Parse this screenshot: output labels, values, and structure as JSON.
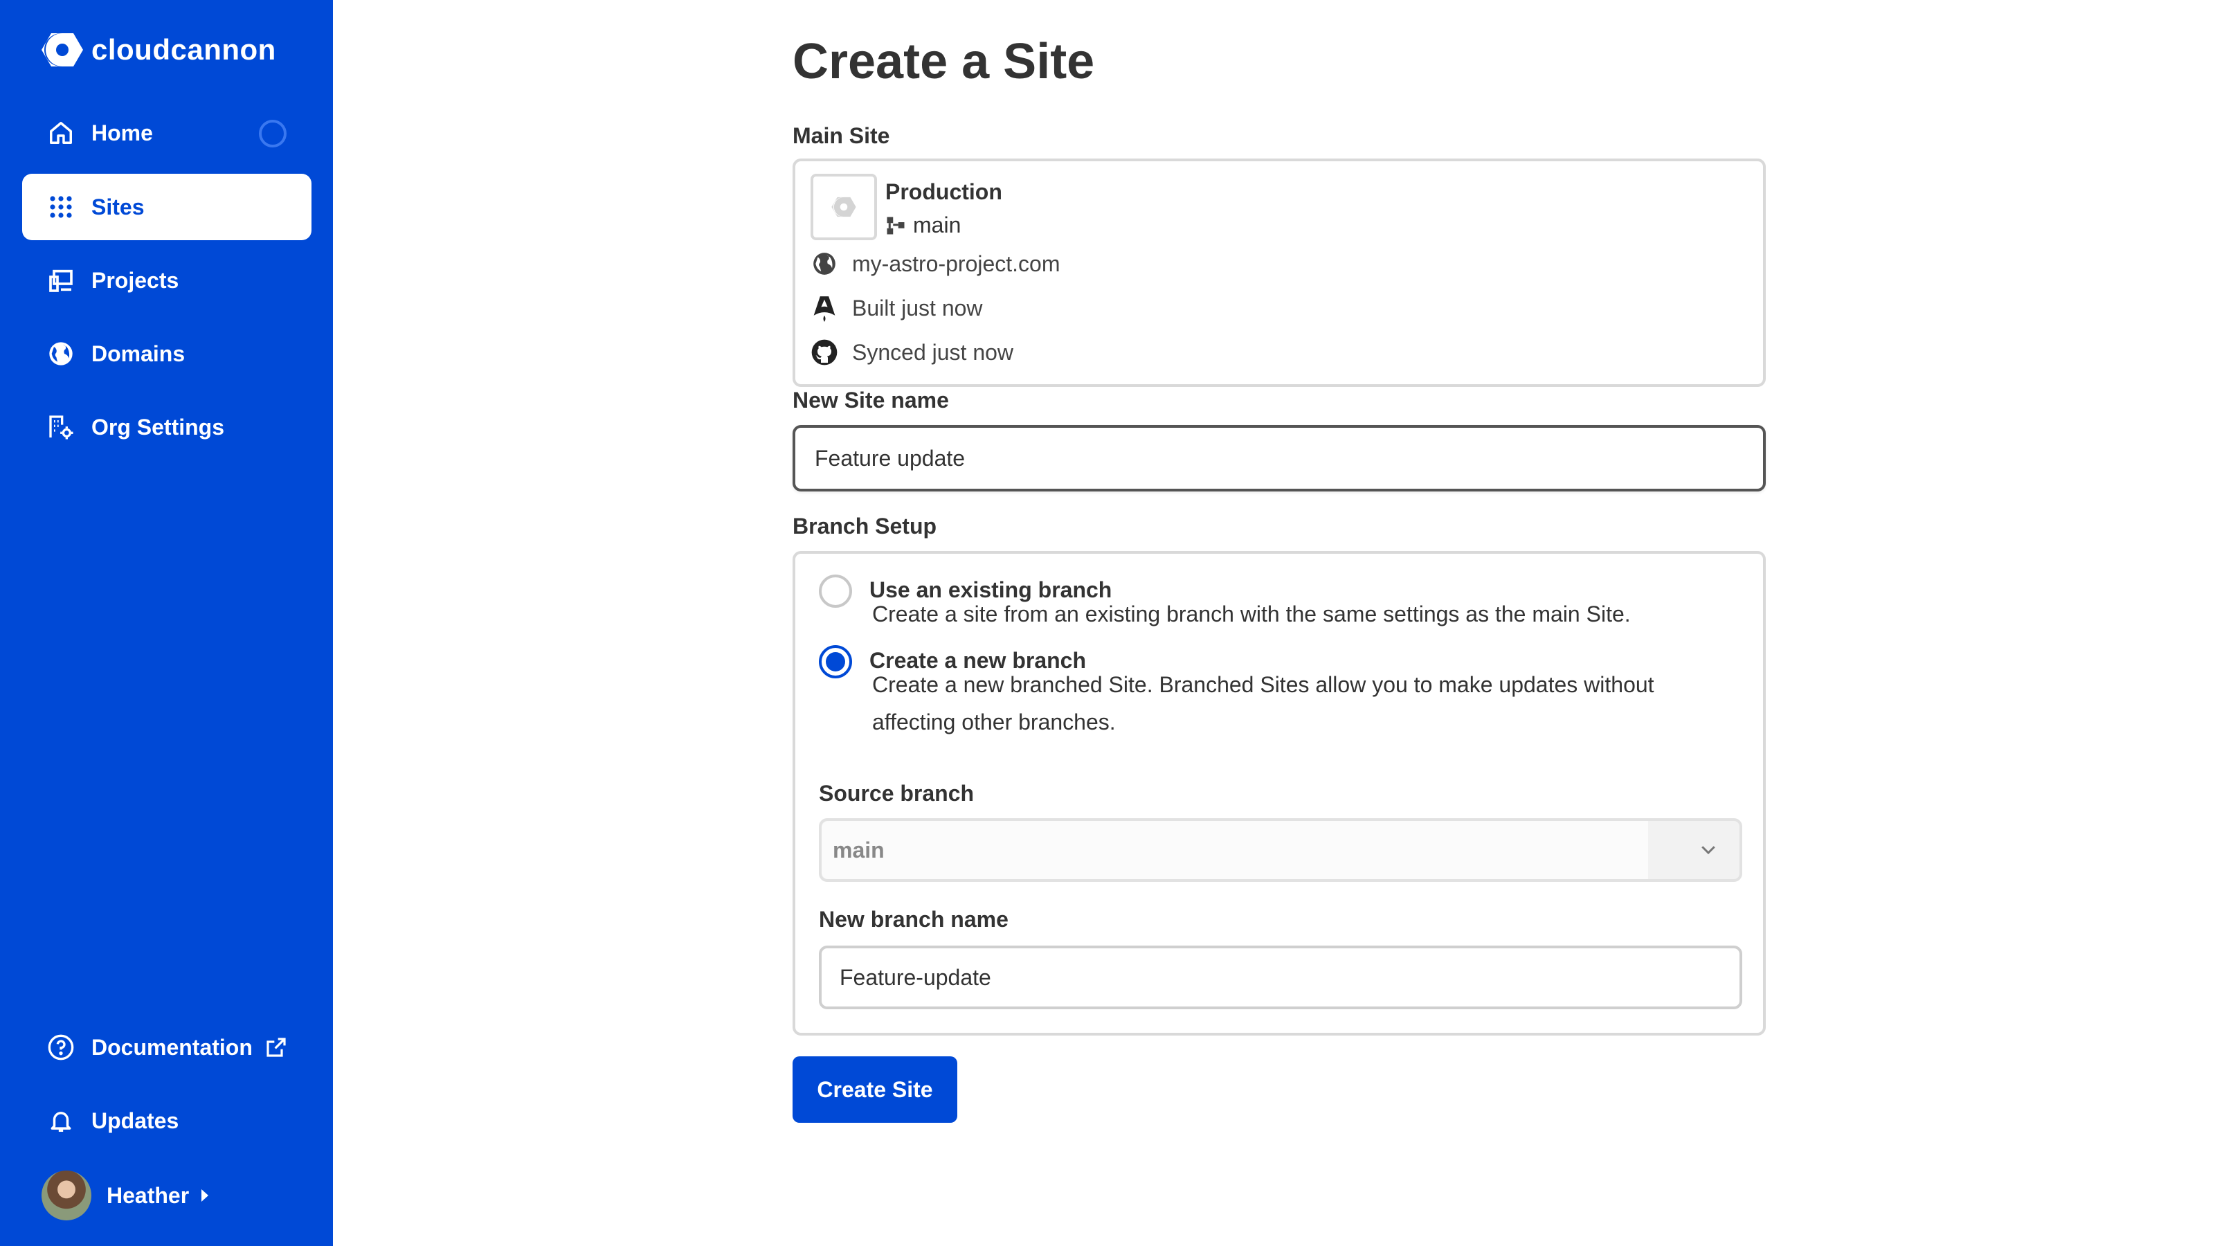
{
  "app": {
    "brand": "cloudcannon",
    "accent_color": "#0049d6"
  },
  "sidebar": {
    "items": [
      {
        "label": "Home",
        "icon": "home-icon"
      },
      {
        "label": "Sites",
        "icon": "grid-dots-icon",
        "active": true
      },
      {
        "label": "Projects",
        "icon": "devices-icon"
      },
      {
        "label": "Domains",
        "icon": "globe-icon"
      },
      {
        "label": "Org Settings",
        "icon": "building-gear-icon"
      }
    ],
    "bottom": {
      "documentation": "Documentation",
      "updates": "Updates",
      "user": "Heather"
    }
  },
  "main": {
    "title": "Create a Site",
    "main_site": {
      "label": "Main Site",
      "environment": "Production",
      "branch": "main",
      "domain": "my-astro-project.com",
      "built": "Built just now",
      "synced": "Synced just now"
    },
    "new_site_name": {
      "label": "New Site name",
      "value": "Feature update"
    },
    "branch_setup": {
      "label": "Branch Setup",
      "options": [
        {
          "title": "Use an existing branch",
          "description": "Create a site from an existing branch with the same settings as the main Site.",
          "selected": false
        },
        {
          "title": "Create a new branch",
          "description": "Create a new branched Site. Branched Sites allow you to make updates without affecting other branches.",
          "selected": true
        }
      ],
      "source_branch": {
        "label": "Source branch",
        "value": "main"
      },
      "new_branch_name": {
        "label": "New branch name",
        "value": "Feature-update"
      }
    },
    "submit_label": "Create Site"
  }
}
